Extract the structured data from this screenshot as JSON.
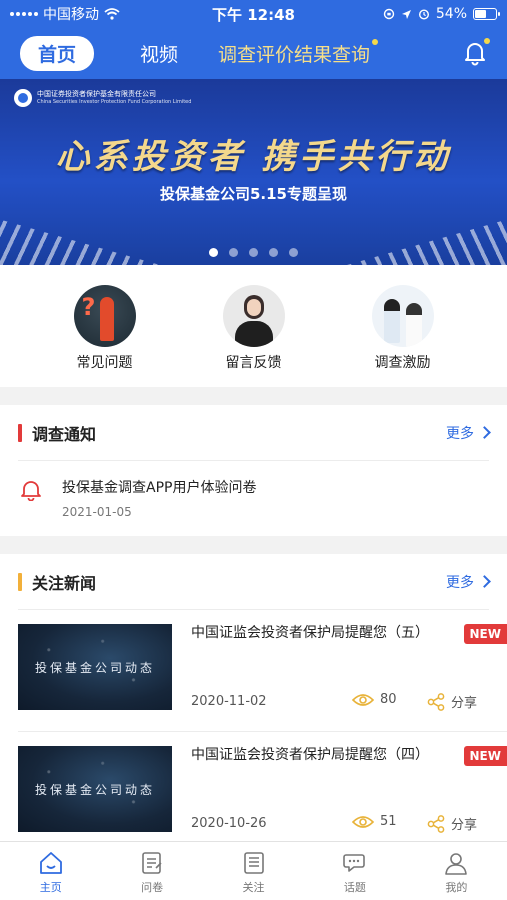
{
  "status": {
    "carrier": "中国移动",
    "time": "下午 12:48",
    "battery": "54%",
    "battery_level": 0.54
  },
  "nav": {
    "tabs": [
      "首页",
      "视频",
      "调查评价结果查询"
    ]
  },
  "banner": {
    "org_cn": "中国证券投资者保护基金有限责任公司",
    "org_en": "China Securities Investor Protection Fund Corporation Limited",
    "slogan": "心系投资者 携手共行动",
    "subtitle": "投保基金公司5.15专题呈现",
    "page_count": 5,
    "active_page": 1
  },
  "quick": [
    {
      "label": "常见问题",
      "icon": "faq-icon"
    },
    {
      "label": "留言反馈",
      "icon": "customer-service-icon"
    },
    {
      "label": "调查激励",
      "icon": "reward-icon"
    }
  ],
  "survey": {
    "title": "调查通知",
    "more": "更多",
    "items": [
      {
        "title": "投保基金调查APP用户体验问卷",
        "date": "2021-01-05"
      }
    ]
  },
  "news": {
    "title": "关注新闻",
    "more": "更多",
    "items": [
      {
        "thumb_text": "投保基金公司动态",
        "title": "中国证监会投资者保护局提醒您（五）",
        "badge": "NEW",
        "date": "2020-11-02",
        "views": "80",
        "share": "分享"
      },
      {
        "thumb_text": "投保基金公司动态",
        "title": "中国证监会投资者保护局提醒您（四）",
        "badge": "NEW",
        "date": "2020-10-26",
        "views": "51",
        "share": "分享"
      }
    ]
  },
  "tabbar": [
    {
      "label": "主页",
      "icon": "home-icon",
      "active": true
    },
    {
      "label": "问卷",
      "icon": "questionnaire-icon",
      "active": false
    },
    {
      "label": "关注",
      "icon": "follow-icon",
      "active": false
    },
    {
      "label": "话题",
      "icon": "topic-icon",
      "active": false
    },
    {
      "label": "我的",
      "icon": "profile-icon",
      "active": false
    }
  ],
  "colors": {
    "primary": "#2f6be0",
    "accent_yellow": "#f6df8a",
    "alert_red": "#e23a3a"
  }
}
